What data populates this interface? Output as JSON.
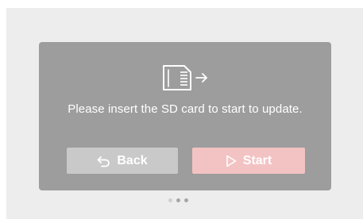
{
  "dialog": {
    "message": "Please insert the SD card to start to update.",
    "icon": "sd-card-insert-icon"
  },
  "buttons": {
    "back_label": "Back",
    "back_icon": "undo-arrow-icon",
    "start_label": "Start",
    "start_icon": "play-outline-icon"
  },
  "pager": {
    "page_count": 3,
    "dot_colors": [
      "#cfcfcf",
      "#a7a7a7",
      "#a7a7a7"
    ]
  },
  "colors": {
    "screen_bg": "#ededed",
    "dialog_bg": "#9c9d9c",
    "back_button_bg": "#c8c9c8",
    "start_button_bg": "#f3c3c3",
    "text": "#ffffff"
  }
}
